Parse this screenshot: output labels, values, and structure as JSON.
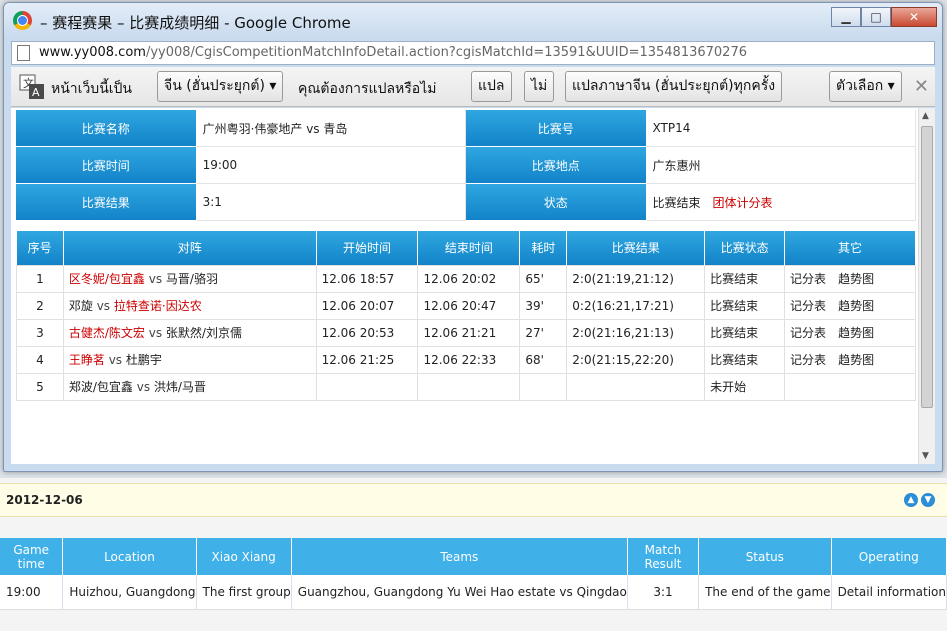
{
  "window": {
    "title": "– 赛程赛果 – 比赛成绩明细 - Google Chrome",
    "controls": {
      "minimize": "▁",
      "maximize": "□",
      "close": "✕"
    }
  },
  "address_bar": {
    "host": "www.yy008.com",
    "path": "/yy008/CgisCompetitionMatchInfoDetail.action?cgisMatchId=13591&UUID=1354813670276"
  },
  "translate_bar": {
    "prefix": "หน้าเว็บนี้เป็น",
    "language": "จีน (ฮั่นประยุกต์)",
    "question": "คุณต้องการแปลหรือไม่",
    "translate": "แปล",
    "no": "ไม่",
    "always": "แปลภาษาจีน (ฮั่นประยุกต์)ทุกครั้ง",
    "options": "ตัวเลือก",
    "close": "✕"
  },
  "match_info": {
    "rows": [
      {
        "l1": "比赛名称",
        "v1": "广州粤羽·伟豪地产 vs 青岛",
        "l2": "比赛号",
        "v2": "XTP14"
      },
      {
        "l1": "比赛时间",
        "v1": "19:00",
        "l2": "比赛地点",
        "v2": "广东惠州"
      },
      {
        "l1": "比赛结果",
        "v1": "3:1",
        "l2": "状态",
        "v2": "比赛结束"
      }
    ],
    "team_score_link": "团体计分表"
  },
  "matches": {
    "headers": [
      "序号",
      "对阵",
      "开始时间",
      "结束时间",
      "耗时",
      "比赛结果",
      "比赛状态",
      "其它"
    ],
    "rows": [
      {
        "no": "1",
        "left": "区冬妮/包宜鑫",
        "vs": "vs",
        "right": "马晋/骆羽",
        "start": "12.06 18:57",
        "end": "12.06 20:02",
        "dur": "65'",
        "result": "2:0(21:19,21:12)",
        "status": "比赛结束",
        "op1": "记分表",
        "op2": "趋势图"
      },
      {
        "no": "2",
        "left": "邓旋",
        "vs": "vs",
        "right": "拉特查诺·因达农",
        "start": "12.06 20:07",
        "end": "12.06 20:47",
        "dur": "39'",
        "result": "0:2(16:21,17:21)",
        "status": "比赛结束",
        "op1": "记分表",
        "op2": "趋势图"
      },
      {
        "no": "3",
        "left": "古健杰/陈文宏",
        "vs": "vs",
        "right": "张默然/刘京儒",
        "start": "12.06 20:53",
        "end": "12.06 21:21",
        "dur": "27'",
        "result": "2:0(21:16,21:13)",
        "status": "比赛结束",
        "op1": "记分表",
        "op2": "趋势图"
      },
      {
        "no": "4",
        "left": "王睁茗",
        "vs": "vs",
        "right": "杜鹏宇",
        "start": "12.06 21:25",
        "end": "12.06 22:33",
        "dur": "68'",
        "result": "2:0(21:15,22:20)",
        "status": "比赛结束",
        "op1": "记分表",
        "op2": "趋势图"
      },
      {
        "no": "5",
        "left": "郑波/包宜鑫",
        "vs": "vs",
        "right": "洪炜/马晋",
        "start": "",
        "end": "",
        "dur": "",
        "result": "",
        "status": "未开始",
        "op1": "",
        "op2": ""
      }
    ]
  },
  "background_page": {
    "date": "2012-12-06",
    "headers": [
      "Game time",
      "Location",
      "Xiao Xiang",
      "Teams",
      "Match Result",
      "Status",
      "Operating"
    ],
    "row": [
      "19:00",
      "Huizhou, Guangdong",
      "The first group",
      "Guangzhou, Guangdong Yu Wei Hao estate vs Qingdao",
      "3:1",
      "The end of the game",
      "Detail information"
    ]
  }
}
